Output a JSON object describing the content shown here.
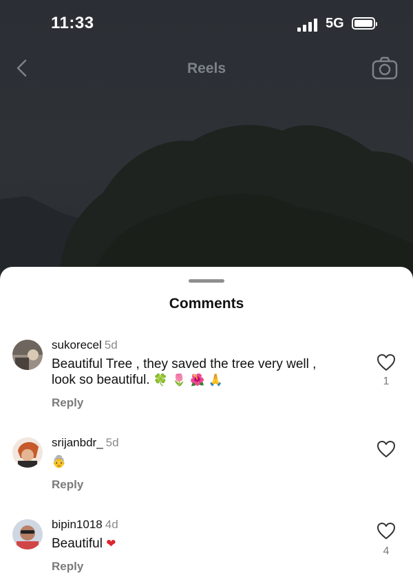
{
  "status_bar": {
    "time": "11:33",
    "network": "5G"
  },
  "nav": {
    "title": "Reels"
  },
  "sheet": {
    "title": "Comments"
  },
  "comments": [
    {
      "username": "sukorecel",
      "age": "5d",
      "line1": "Beautiful Tree , they saved  the tree very well ,",
      "line2": "look so  beautiful.",
      "emoji": "🍀 🌷 🌺 🙏",
      "reply": "Reply",
      "likes": "1"
    },
    {
      "username": "srijanbdr_",
      "age": "5d",
      "emoji": "👵",
      "reply": "Reply",
      "likes": ""
    },
    {
      "username": "bipin1018",
      "age": "4d",
      "line1": "Beautiful",
      "emoji": "❤",
      "reply": "Reply",
      "likes": "4"
    }
  ],
  "colors": {
    "sheet_bg": "#ffffff",
    "heart_red": "#e0242f",
    "muted": "#7a7a7a"
  }
}
